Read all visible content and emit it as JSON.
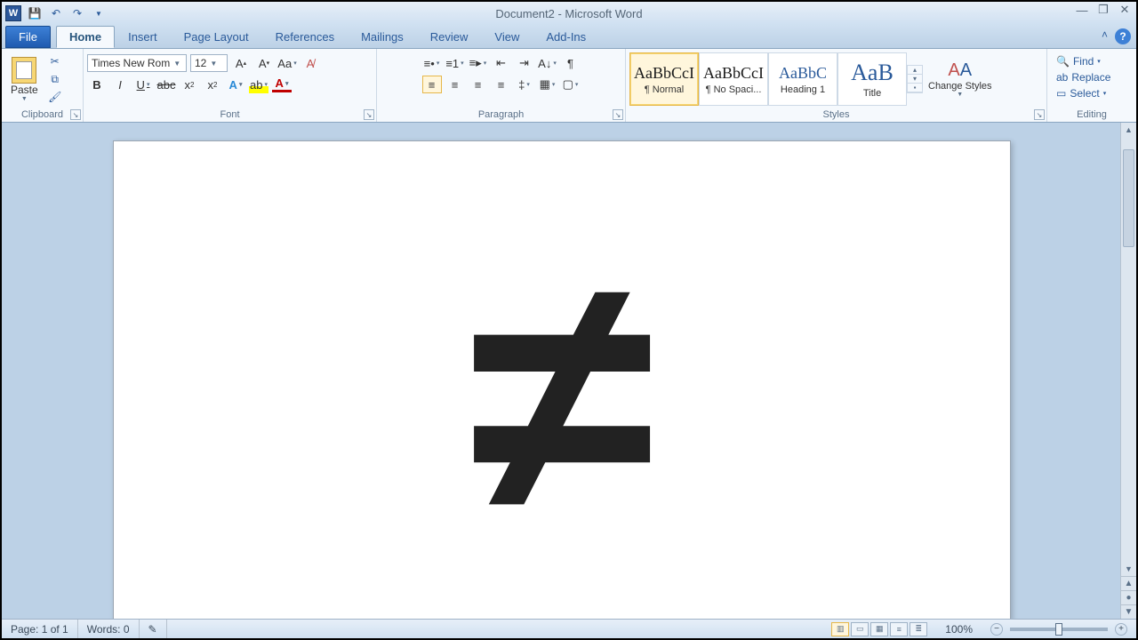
{
  "title": "Document2  -  Microsoft Word",
  "tabs": {
    "file": "File",
    "items": [
      "Home",
      "Insert",
      "Page Layout",
      "References",
      "Mailings",
      "Review",
      "View",
      "Add-Ins"
    ],
    "active": 0
  },
  "clipboard": {
    "paste": "Paste",
    "label": "Clipboard"
  },
  "font": {
    "name": "Times New Rom",
    "size": "12",
    "label": "Font"
  },
  "paragraph": {
    "label": "Paragraph"
  },
  "styles": {
    "label": "Styles",
    "items": [
      {
        "preview": "AaBbCcI",
        "name": "¶ Normal",
        "sel": true,
        "cls": ""
      },
      {
        "preview": "AaBbCcI",
        "name": "¶ No Spaci...",
        "sel": false,
        "cls": ""
      },
      {
        "preview": "AaBbC",
        "name": "Heading 1",
        "sel": false,
        "cls": "blue"
      },
      {
        "preview": "AaB",
        "name": "Title",
        "sel": false,
        "cls": "blue big"
      }
    ],
    "change": "Change Styles"
  },
  "editing": {
    "find": "Find",
    "replace": "Replace",
    "select": "Select",
    "label": "Editing"
  },
  "document": {
    "symbol": "≠"
  },
  "status": {
    "page": "Page: 1 of 1",
    "words": "Words: 0",
    "zoom": "100%"
  }
}
